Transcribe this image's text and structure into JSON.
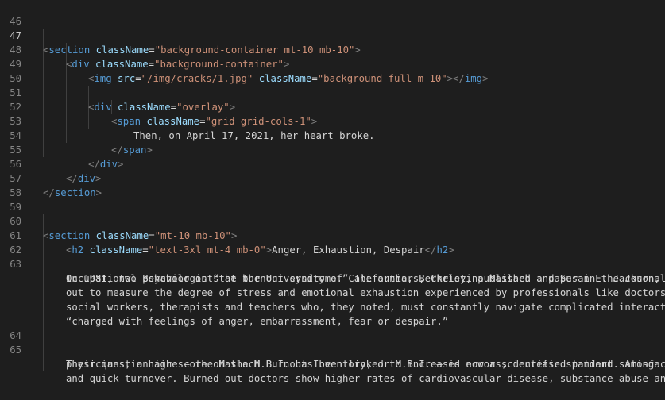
{
  "editor": {
    "active_line": "47",
    "line_numbers": {
      "l46": "46",
      "l47": "47",
      "l48": "48",
      "l49": "49",
      "l50": "50",
      "l51": "51",
      "l52": "52",
      "l53": "53",
      "l54": "54",
      "l55": "55",
      "l56": "56",
      "l57": "57",
      "l58": "58",
      "l59": "59",
      "l60": "60",
      "l61": "61",
      "l62": "62",
      "l63": "63",
      "l64": "64",
      "l65": "65"
    },
    "code": {
      "l47_open": "<",
      "l47_tag": "section",
      "l47_attr": "className",
      "l47_eq": "=",
      "l47_val": "\"background-container mt-10 mb-10\"",
      "l47_close": ">",
      "l48_open": "<",
      "l48_tag": "div",
      "l48_attr": "className",
      "l48_eq": "=",
      "l48_val": "\"background-container\"",
      "l48_close": ">",
      "l49_open": "<",
      "l49_tag": "img",
      "l49_attr1": "src",
      "l49_eq1": "=",
      "l49_val1": "\"/img/cracks/1.jpg\"",
      "l49_attr2": "className",
      "l49_eq2": "=",
      "l49_val2": "\"background-full m-10\"",
      "l49_mid": "></",
      "l49_tag2": "img",
      "l49_close": ">",
      "l51_open": "<",
      "l51_tag": "div",
      "l51_attr": "className",
      "l51_eq": "=",
      "l51_val": "\"overlay\"",
      "l51_close": ">",
      "l52_open": "<",
      "l52_tag": "span",
      "l52_attr": "className",
      "l52_eq": "=",
      "l52_val": "\"grid grid-cols-1\"",
      "l52_close": ">",
      "l53_text": "Then, on April 17, 2021, her heart broke.",
      "l54_open": "</",
      "l54_tag": "span",
      "l54_close": ">",
      "l55_open": "</",
      "l55_tag": "div",
      "l55_close": ">",
      "l56_open": "</",
      "l56_tag": "div",
      "l56_close": ">",
      "l57_open": "</",
      "l57_tag": "section",
      "l57_close": ">",
      "l60_open": "<",
      "l60_tag": "section",
      "l60_attr": "className",
      "l60_eq": "=",
      "l60_val": "\"mt-10 mb-10\"",
      "l60_close": ">",
      "l61_open": "<",
      "l61_tag": "h2",
      "l61_attr": "className",
      "l61_eq": "=",
      "l61_val": "\"text-3xl mt-4 mb-0\"",
      "l61_close": ">",
      "l61_text": "Anger, Exhaustion, Despair",
      "l61_endopen": "</",
      "l61_tag2": "h2",
      "l61_endclose": ">",
      "l63_w1": "In 1981, two psychologists at the University of California, Berkeley, published a paper in the Journal of",
      "l63_w2": "Occupational Behavior on “the burnout syndrome.” The authors, Christina Maslach and Susan E. Jackson, set",
      "l63_w3": "out to measure the degree of stress and emotional exhaustion experienced by professionals like doctors,",
      "l63_w4": "social workers, therapists and teachers who, they noted, must constantly navigate complicated interaction",
      "l63_w5": "“charged with feelings of anger, embarrassment, fear or despair.”",
      "l65_w1": "Their questionnaire — the Maslach Burnout Inventory, or M.B.I. — is now a scientific standard. Among",
      "l65_w2": "physicians, a high score on the M.B.I. has been linked to increased errors, decreased patient satisfactic",
      "l65_w3": "and quick turnover. Burned-out doctors show higher rates of cardiovascular disease, substance abuse and"
    }
  }
}
